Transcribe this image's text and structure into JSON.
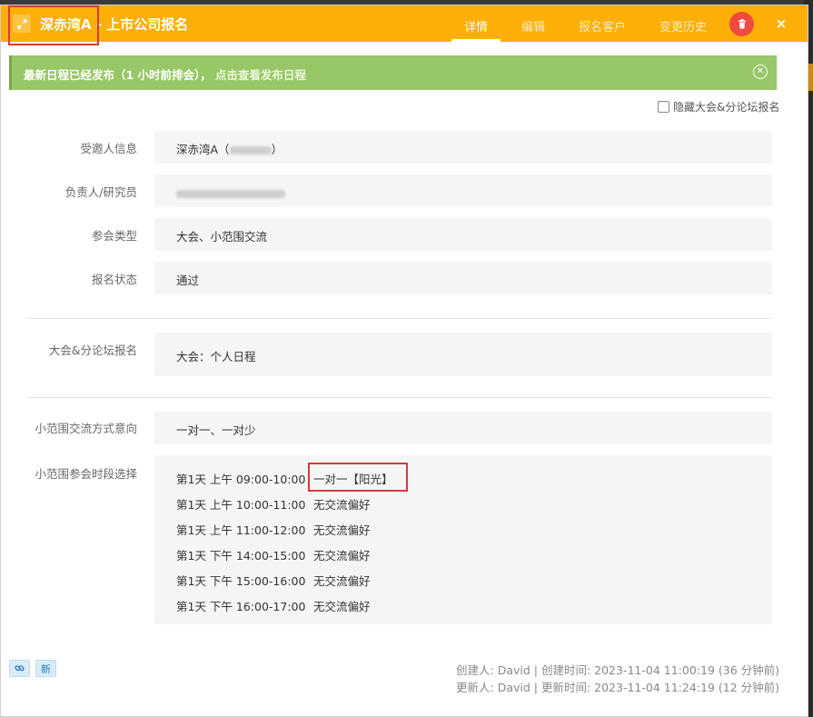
{
  "header": {
    "title": "深赤湾A - 上市公司报名",
    "tabs": [
      {
        "label": "详情",
        "active": true
      },
      {
        "label": "编辑",
        "active": false
      },
      {
        "label": "报名客户",
        "active": false
      },
      {
        "label": "变更历史",
        "active": false
      }
    ],
    "close_label": "×",
    "accent_color": "#fcaf06"
  },
  "alert": {
    "text": "最新日程已经发布（1 小时前排会），",
    "link": "点击查看发布日程",
    "close_label": "✕"
  },
  "hide_forum_label": "隐藏大会&分论坛报名",
  "fields": {
    "invitee": {
      "label": "受邀人信息",
      "value": "深赤湾A（",
      "value_suffix": "）"
    },
    "owner": {
      "label": "负责人/研究员"
    },
    "type": {
      "label": "参会类型",
      "value": "大会、小范围交流"
    },
    "status": {
      "label": "报名状态",
      "value": "通过"
    },
    "forum": {
      "label": "大会&分论坛报名",
      "value": "大会：个人日程"
    },
    "mode": {
      "label": "小范围交流方式意向",
      "value": "一对一、一对少"
    },
    "slots_label": "小范围参会时段选择"
  },
  "slots": [
    {
      "day": "第1天 上午 09:00-10:00",
      "pref": "一对一【阳光】"
    },
    {
      "day": "第1天 上午 10:00-11:00",
      "pref": "无交流偏好"
    },
    {
      "day": "第1天 上午 11:00-12:00",
      "pref": "无交流偏好"
    },
    {
      "day": "第1天 下午 14:00-15:00",
      "pref": "无交流偏好"
    },
    {
      "day": "第1天 下午 15:00-16:00",
      "pref": "无交流偏好"
    },
    {
      "day": "第1天 下午 16:00-17:00",
      "pref": "无交流偏好"
    }
  ],
  "footer": {
    "link_icon_label": "🔗",
    "new_label": "新",
    "created": "创建人: David | 创建时间: 2023-11-04 11:00:19 (36 分钟前)",
    "updated": "更新人: David | 更新时间: 2023-11-04 11:24:19 (12 分钟前)"
  }
}
